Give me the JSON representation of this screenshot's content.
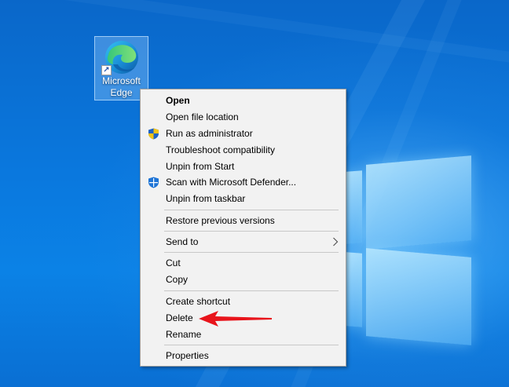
{
  "desktop": {
    "icon": {
      "name": "Microsoft Edge",
      "line1": "Microsoft",
      "line2": "Edge",
      "shortcut_glyph": "↗"
    }
  },
  "context_menu": {
    "items": [
      {
        "label": "Open",
        "bold": true
      },
      {
        "label": "Open file location"
      },
      {
        "label": "Run as administrator",
        "icon": "uac-shield-icon"
      },
      {
        "label": "Troubleshoot compatibility"
      },
      {
        "label": "Unpin from Start"
      },
      {
        "label": "Scan with Microsoft Defender...",
        "icon": "defender-icon"
      },
      {
        "label": "Unpin from taskbar"
      },
      {
        "label": "Restore previous versions"
      },
      {
        "label": "Send to",
        "submenu": true,
        "icon": "chevron-right-icon"
      },
      {
        "label": "Cut"
      },
      {
        "label": "Copy"
      },
      {
        "label": "Create shortcut"
      },
      {
        "label": "Delete"
      },
      {
        "label": "Rename"
      },
      {
        "label": "Properties"
      }
    ]
  },
  "annotation": {
    "arrow_color": "#e8141b",
    "points_to": "Delete"
  },
  "colors": {
    "desktop_blue": "#0a78de",
    "menu_background": "#f2f2f2",
    "menu_border": "#a0a0a0",
    "separator": "#c8c8c8"
  }
}
